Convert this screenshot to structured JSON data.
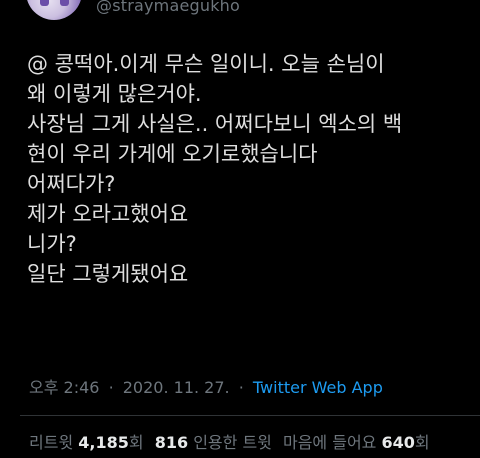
{
  "header": {
    "handle": "@straymaegukho"
  },
  "tweet": {
    "lines": [
      "@ 콩떡아.이게 무슨 일이니. 오늘 손님이",
      "왜 이렇게 많은거야.",
      "사장님 그게 사실은.. 어쩌다보니 엑소의 백",
      "현이 우리 가게에 오기로했습니다",
      "어쩌다가?",
      "제가 오라고했어요",
      "니가?",
      "일단 그렇게됐어요"
    ]
  },
  "meta": {
    "time": "오후 2:46",
    "separator": "·",
    "date": "2020. 11. 27.",
    "source": "Twitter Web App"
  },
  "stats": {
    "retweets_label": "리트윗",
    "retweets": "4,185",
    "retweets_suffix": "회",
    "quotes": "816",
    "quotes_label": "인용한 트윗",
    "likes_label": "마음에 들어요",
    "likes": "640",
    "likes_suffix": "회"
  },
  "colors": {
    "background": "#000000",
    "text": "#dedede",
    "muted": "#6e767d",
    "link": "#1d9bf0"
  }
}
